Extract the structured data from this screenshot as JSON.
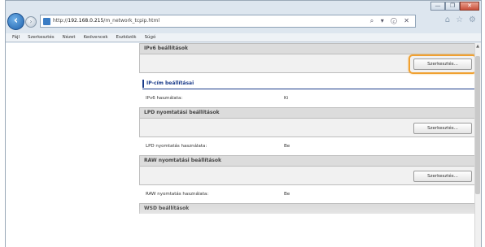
{
  "browser": {
    "url_prefix": "http://",
    "url_host": "192.168.0.215",
    "url_path": "/m_network_tcpip.html",
    "search_ctrl": "⌕ ▾ ⓒ ✕",
    "caption_buttons": [
      "—",
      "❐",
      "✕"
    ],
    "toolbar_icons": [
      "home-icon",
      "star-icon",
      "gear-icon"
    ]
  },
  "menu": [
    "Fájl",
    "Szerkesztés",
    "Nézet",
    "Kedvencek",
    "Eszközök",
    "Súgó"
  ],
  "sections": {
    "ipv6": {
      "header": "IPv6 beállítások",
      "edit_label": "Szerkesztés...",
      "subsection": "IP-cím beállításai",
      "row_label": "IPv6 használata:",
      "row_value": "Ki"
    },
    "lpd": {
      "header": "LPD nyomtatási beállítások",
      "edit_label": "Szerkesztés...",
      "row_label": "LPD nyomtatás használata:",
      "row_value": "Be"
    },
    "raw": {
      "header": "RAW nyomtatási beállítások",
      "edit_label": "Szerkesztés...",
      "row_label": "RAW nyomtatás használata:",
      "row_value": "Be"
    },
    "wsd": {
      "header": "WSD beállítások"
    }
  },
  "colors": {
    "highlight": "#f0a030",
    "subsection_accent": "#1b3c8a"
  }
}
